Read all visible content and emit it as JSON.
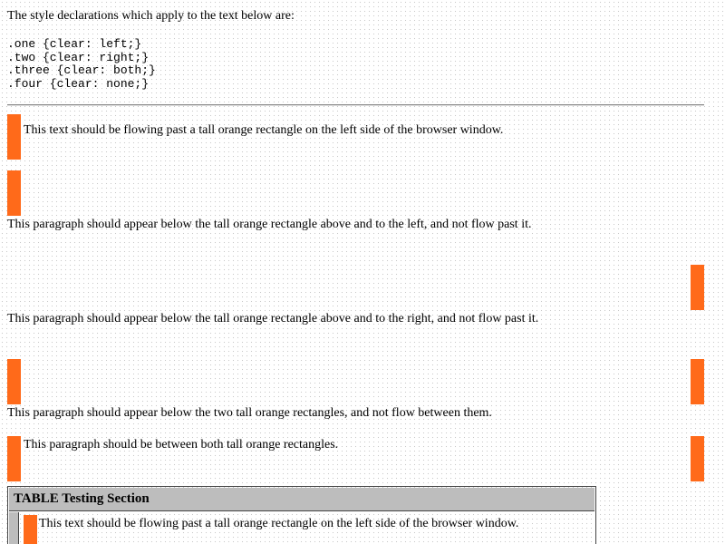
{
  "intro_text": "The style declarations which apply to the text below are:",
  "code_lines": [
    ".one {clear: left;}",
    ".two {clear: right;}",
    ".three {clear: both;}",
    ".four {clear: none;}"
  ],
  "paragraphs": {
    "p1": "This text should be flowing past a tall orange rectangle on the left side of the browser window.",
    "p2": "This paragraph should appear below the tall orange rectangle above and to the left, and not flow past it.",
    "p3": "This paragraph should appear below the tall orange rectangle above and to the right, and not flow past it.",
    "p4": "This paragraph should appear below the two tall orange rectangles, and not flow between them.",
    "p5": "This paragraph should be between both tall orange rectangles."
  },
  "table": {
    "header": "TABLE Testing Section",
    "row1_text": "This text should be flowing past a tall orange rectangle on the left side of the browser window."
  },
  "colors": {
    "rectangle": "#ff6a1a",
    "table_header_bg": "#bdbdbd"
  }
}
